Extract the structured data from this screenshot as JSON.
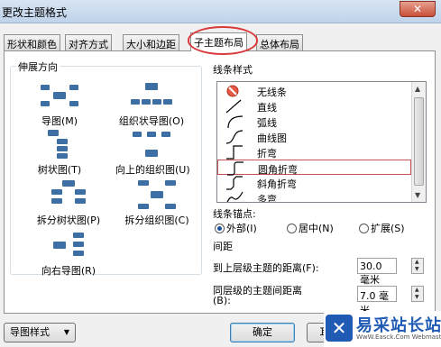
{
  "window": {
    "title": "更改主题格式",
    "close_glyph": "✕"
  },
  "tabs": [
    {
      "label": "形状和颜色"
    },
    {
      "label": "对齐方式"
    },
    {
      "label": "大小和边距"
    },
    {
      "label": "子主题布局"
    },
    {
      "label": "总体布局"
    }
  ],
  "expand_direction": {
    "title": "伸展方向",
    "items": [
      {
        "label": "导图(M)",
        "icon": "mindmap-layout-icon"
      },
      {
        "label": "组织状导图(O)",
        "icon": "org-chart-layout-icon"
      },
      {
        "label": "树状图(T)",
        "icon": "tree-layout-icon"
      },
      {
        "label": "向上的组织图(U)",
        "icon": "upward-org-layout-icon"
      },
      {
        "label": "拆分树状图(P)",
        "icon": "split-tree-layout-icon"
      },
      {
        "label": "拆分组织图(C)",
        "icon": "split-org-layout-icon"
      },
      {
        "label": "向右导图(R)",
        "icon": "right-mindmap-layout-icon"
      }
    ]
  },
  "line_style": {
    "title": "线条样式",
    "items": [
      {
        "label": "无线条",
        "icon": "no-line-icon"
      },
      {
        "label": "直线",
        "icon": "straight-line-icon"
      },
      {
        "label": "弧线",
        "icon": "arc-line-icon"
      },
      {
        "label": "曲线图",
        "icon": "curve-line-icon"
      },
      {
        "label": "折弯",
        "icon": "elbow-line-icon"
      },
      {
        "label": "圆角折弯",
        "icon": "rounded-elbow-line-icon"
      },
      {
        "label": "斜角折弯",
        "icon": "bevel-elbow-line-icon"
      },
      {
        "label": "多弯",
        "icon": "multi-bend-line-icon"
      }
    ],
    "selected_index": 5
  },
  "anchor": {
    "title": "线条锚点:",
    "options": [
      {
        "label": "外部(I)",
        "checked": true
      },
      {
        "label": "居中(N)",
        "checked": false
      },
      {
        "label": "扩展(S)",
        "checked": false
      }
    ]
  },
  "spacing": {
    "title": "间距",
    "parent_label": "到上层级主题的距离(F):",
    "parent_value": "30.0 毫米",
    "sibling_label": "同层级的主题间距离",
    "sibling_label_2": "(B):",
    "sibling_value": "7.0 毫米"
  },
  "footer": {
    "style_button": "导图样式",
    "ok_button": "确定",
    "cancel_button_partial": "耳"
  },
  "watermark": {
    "logo_glyph": "✕",
    "text": "易采站长站",
    "sub": "WwW.Easck.Com Webmaster"
  },
  "colors": {
    "accent": "#3d6fa5",
    "highlight": "#d9393a"
  }
}
